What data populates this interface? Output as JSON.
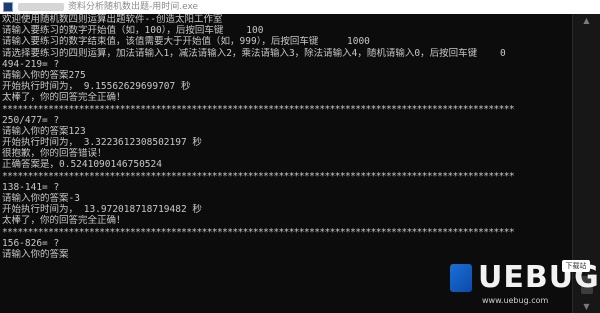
{
  "window": {
    "title": "资料分析随机数出题-用时间.exe"
  },
  "console": {
    "lines": [
      "欢迎使用随机数四则运算出题软件--创造太阳工作室",
      "请输入要练习的数字开始值（如，100），后按回车键    100",
      "请输入要练习的数字结束值，该值需要大于开始值（如，999），后按回车键     1000",
      "请选择要练习的四则运算，加法请输入1，减法请输入2，乘法请输入3，除法请输入4，随机请输入0，后按回车键    0",
      "494-219= ?",
      "请输入你的答案275",
      "开始执行时间为， 9.15562629699707 秒",
      "太棒了，你的回答完全正确！",
      "****************************************************************************************************",
      "250/477= ?",
      "请输入你的答案123",
      "开始执行时间为， 3.3223612308502197 秒",
      "很抱歉，你的回答错误！",
      "正确答案是，0.5241090146750524",
      "****************************************************************************************************",
      "138-141= ?",
      "请输入你的答案-3",
      "开始执行时间为， 13.972018718719482 秒",
      "太棒了，你的回答完全正确！",
      "****************************************************************************************************",
      "156-826= ?",
      "请输入你的答案"
    ]
  },
  "watermark": {
    "logo_text": "UEBUG",
    "badge": "下载站",
    "sub": "www.uebug.com"
  },
  "colors": {
    "console_bg": "#0c0c0c",
    "console_text": "#c7c7c7",
    "titlebar_bg": "#ffffff"
  }
}
